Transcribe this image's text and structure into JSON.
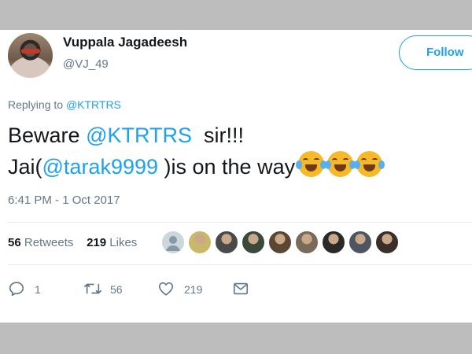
{
  "user": {
    "name": "Vuppala Jagadeesh",
    "handle": "@VJ_49"
  },
  "follow_label": "Follow",
  "reply_context": {
    "prefix": "Replying to ",
    "mention": "@KTRTRS"
  },
  "tweet": {
    "line1_text1": "Beware ",
    "line1_mention": "@KTRTRS",
    "line1_text2": "  sir!!!",
    "line2_text1": "Jai(",
    "line2_mention": "@tarak9999",
    "line2_text2": " )is on the way",
    "emoji": [
      "face-with-tears-of-joy",
      "face-with-tears-of-joy",
      "face-with-tears-of-joy"
    ]
  },
  "timestamp": "6:41 PM - 1 Oct 2017",
  "stats": {
    "retweets_count": "56",
    "retweets_label": "Retweets",
    "likes_count": "219",
    "likes_label": "Likes"
  },
  "likers": [
    {
      "icon": "default-avatar",
      "color": "#ccd6dd"
    },
    {
      "icon": "avatar",
      "color": "#c9b86a"
    },
    {
      "icon": "avatar",
      "color": "#4a4a4a"
    },
    {
      "icon": "avatar",
      "color": "#3a4a3a"
    },
    {
      "icon": "avatar",
      "color": "#5a4632"
    },
    {
      "icon": "avatar",
      "color": "#7a6a5a"
    },
    {
      "icon": "avatar",
      "color": "#2a2a2a"
    },
    {
      "icon": "avatar",
      "color": "#4f5560"
    },
    {
      "icon": "avatar",
      "color": "#3b2f2a"
    }
  ],
  "actions": {
    "reply_count": "1",
    "retweet_count": "56",
    "like_count": "219"
  },
  "colors": {
    "accent": "#1da1f2",
    "text_secondary": "#657786"
  }
}
